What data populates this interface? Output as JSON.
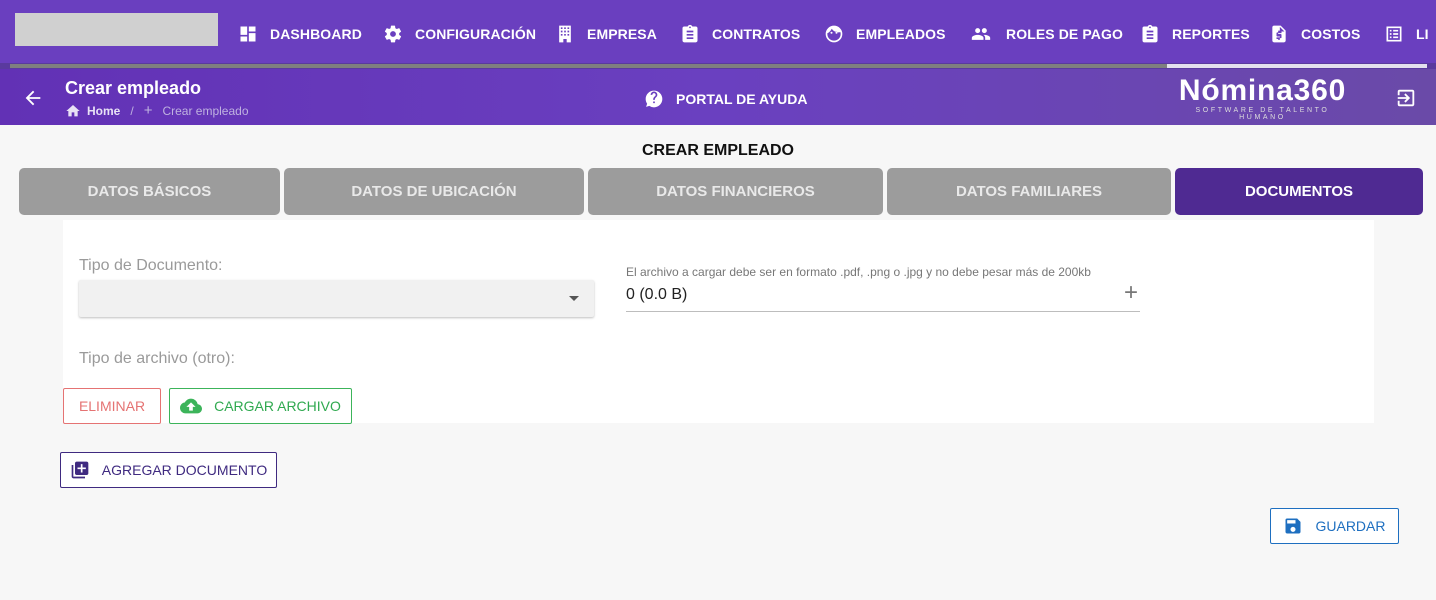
{
  "nav": {
    "items": [
      {
        "label": "DASHBOARD",
        "icon": "dashboard-icon"
      },
      {
        "label": "CONFIGURACIÓN",
        "icon": "gear-icon"
      },
      {
        "label": "EMPRESA",
        "icon": "building-icon"
      },
      {
        "label": "CONTRATOS",
        "icon": "clipboard-icon"
      },
      {
        "label": "EMPLEADOS",
        "icon": "face-icon"
      },
      {
        "label": "ROLES DE PAGO",
        "icon": "group-icon"
      },
      {
        "label": "REPORTES",
        "icon": "clipboard-icon"
      },
      {
        "label": "COSTOS",
        "icon": "dollar-file-icon"
      },
      {
        "label": "LI",
        "icon": "list-icon"
      }
    ]
  },
  "header": {
    "title": "Crear empleado",
    "breadcrumb": {
      "home": "Home",
      "separator": "/",
      "current": "Crear empleado"
    },
    "help_label": "PORTAL DE AYUDA",
    "brand_name": "Nómina360",
    "brand_tagline": "SOFTWARE DE TALENTO HUMANO"
  },
  "form": {
    "title": "CREAR EMPLEADO",
    "tabs": [
      {
        "label": "DATOS BÁSICOS",
        "active": false
      },
      {
        "label": "DATOS DE UBICACIÓN",
        "active": false
      },
      {
        "label": "DATOS FINANCIEROS",
        "active": false
      },
      {
        "label": "DATOS FAMILIARES",
        "active": false
      },
      {
        "label": "DOCUMENTOS",
        "active": true
      }
    ],
    "tipo_documento_label": "Tipo de Documento:",
    "tipo_documento_value": "",
    "file_hint": "El archivo a cargar debe ser en formato .pdf, .png o .jpg y no debe pesar más de 200kb",
    "file_value": "0 (0.0 B)",
    "tipo_archivo_label": "Tipo de archivo (otro):",
    "eliminar_label": "ELIMINAR",
    "cargar_label": "CARGAR ARCHIVO",
    "agregar_label": "AGREGAR DOCUMENTO",
    "guardar_label": "GUARDAR"
  },
  "colors": {
    "nav_bg": "#6a3fbf",
    "active_tab": "#4f2a92",
    "inactive_tab": "#9c9c9c",
    "danger": "#e57373",
    "success": "#3cb45a",
    "primary": "#1e6fc0"
  }
}
